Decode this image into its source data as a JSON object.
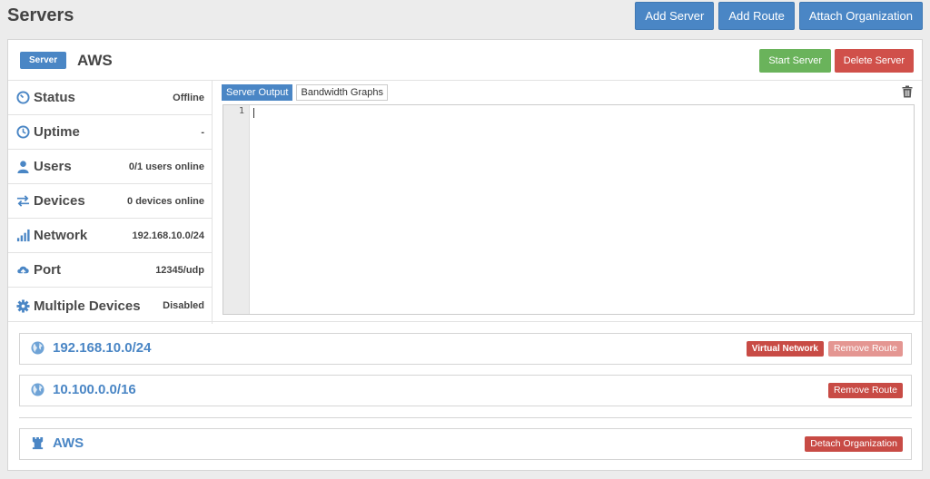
{
  "page": {
    "title": "Servers"
  },
  "top_actions": {
    "add_server": "Add Server",
    "add_route": "Add Route",
    "attach_org": "Attach Organization"
  },
  "server": {
    "badge": "Server",
    "name": "AWS",
    "start_label": "Start Server",
    "delete_label": "Delete Server"
  },
  "info": [
    {
      "label": "Status",
      "value": "Offline",
      "icon": "gauge-icon"
    },
    {
      "label": "Uptime",
      "value": "-",
      "icon": "clock-icon"
    },
    {
      "label": "Users",
      "value": "0/1 users online",
      "icon": "user-icon"
    },
    {
      "label": "Devices",
      "value": "0 devices online",
      "icon": "transfer-icon"
    },
    {
      "label": "Network",
      "value": "192.168.10.0/24",
      "icon": "signal-bars-icon"
    },
    {
      "label": "Port",
      "value": "12345/udp",
      "icon": "cloud-upload-icon"
    },
    {
      "label": "Multiple Devices",
      "value": "Disabled",
      "icon": "gear-icon"
    }
  ],
  "output": {
    "tabs": [
      "Server Output",
      "Bandwidth Graphs"
    ],
    "active_tab": "Server Output",
    "line_number": "1"
  },
  "routes": [
    {
      "network": "192.168.10.0/24",
      "virtual_label": "Virtual Network",
      "remove_label": "Remove Route",
      "remove_disabled": true
    },
    {
      "network": "10.100.0.0/16",
      "remove_label": "Remove Route",
      "remove_disabled": false
    }
  ],
  "organization": {
    "name": "AWS",
    "detach_label": "Detach Organization"
  },
  "colors": {
    "primary": "#4a86c5",
    "success": "#6ab35b",
    "danger": "#d0504a",
    "danger_faded": "#e49692"
  }
}
